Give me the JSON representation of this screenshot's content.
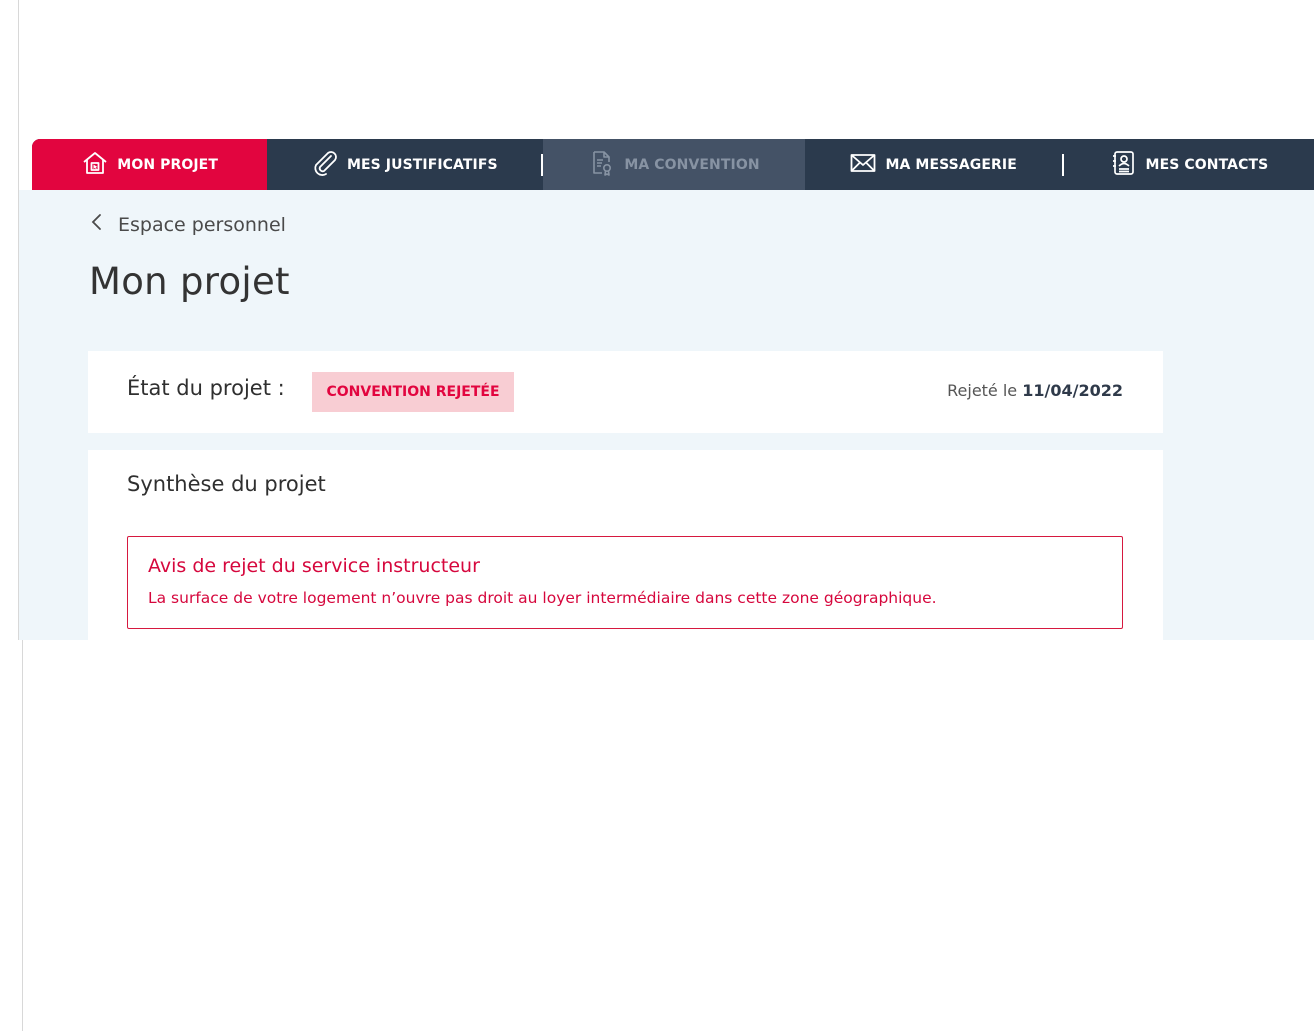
{
  "nav": {
    "items": [
      {
        "label": "MON PROJET",
        "icon": "house-icon",
        "state": "active"
      },
      {
        "label": "MES JUSTIFICATIFS",
        "icon": "paperclip-icon",
        "state": "default"
      },
      {
        "label": "MA CONVENTION",
        "icon": "certificate-document-icon",
        "state": "disabled"
      },
      {
        "label": "MA MESSAGERIE",
        "icon": "envelope-icon",
        "state": "default"
      },
      {
        "label": "MES CONTACTS",
        "icon": "contact-book-icon",
        "state": "default"
      }
    ]
  },
  "breadcrumb": {
    "back_label": "Espace personnel"
  },
  "page": {
    "title": "Mon projet"
  },
  "project_state": {
    "label": "État du projet :",
    "status_badge": "CONVENTION REJETÉE",
    "rejected_prefix": "Rejeté le",
    "rejected_date": "11/04/2022"
  },
  "synthesis": {
    "title": "Synthèse du projet",
    "alert_title": "Avis de rejet du service instructeur",
    "alert_text": "La surface de votre logement n’ouvre pas droit au loyer intermédiaire dans cette zone géographique."
  },
  "colors": {
    "brand_red": "#e2053f",
    "nav_dark": "#2b3a4d",
    "content_bg": "#eff6fa",
    "badge_bg": "#f8cdd3"
  }
}
